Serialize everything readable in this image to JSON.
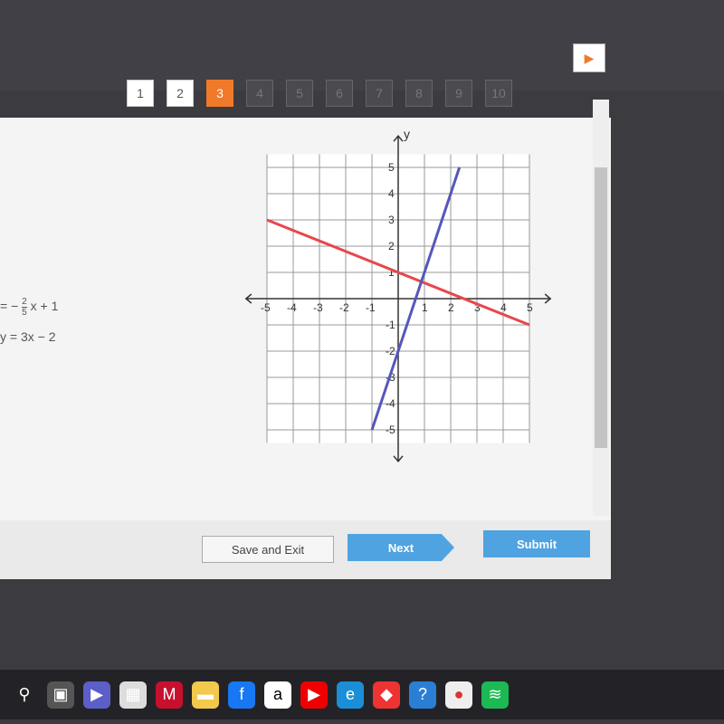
{
  "nav": {
    "pages": [
      {
        "label": "1",
        "state": "visited"
      },
      {
        "label": "2",
        "state": "visited"
      },
      {
        "label": "3",
        "state": "current"
      },
      {
        "label": "4",
        "state": "locked"
      },
      {
        "label": "5",
        "state": "locked"
      },
      {
        "label": "6",
        "state": "locked"
      },
      {
        "label": "7",
        "state": "locked"
      },
      {
        "label": "8",
        "state": "locked"
      },
      {
        "label": "9",
        "state": "locked"
      },
      {
        "label": "10",
        "state": "locked"
      }
    ],
    "next_icon": "play-arrow-icon",
    "accent": "#f07a2a"
  },
  "question": {
    "eq1": {
      "lhs": "=",
      "sign": "−",
      "num": "2",
      "den": "5",
      "rest": "x + 1"
    },
    "eq2": "y = 3x − 2"
  },
  "graph": {
    "y_label": "y",
    "x_ticks": [
      "-5",
      "-4",
      "-3",
      "-2",
      "-1",
      "1",
      "2",
      "3",
      "4",
      "5"
    ],
    "y_ticks": [
      "5",
      "4",
      "3",
      "2",
      "1",
      "-1",
      "-2",
      "-3",
      "-4",
      "-5"
    ],
    "lines": [
      {
        "equation": "y = -2/5x + 1",
        "color": "#e8474a",
        "slope": -0.4,
        "intercept": 1,
        "x_range": [
          -5,
          5
        ]
      },
      {
        "equation": "y = 3x - 2",
        "color": "#5558b8",
        "slope": 3,
        "intercept": -2,
        "x_range": [
          -1,
          2.333
        ]
      }
    ],
    "xlim": [
      -5,
      5
    ],
    "ylim": [
      -5,
      5
    ]
  },
  "buttons": {
    "save": "Save and Exit",
    "next": "Next",
    "submit": "Submit"
  },
  "taskbar": [
    "search-icon",
    "task-view-icon",
    "teams-icon",
    "store-icon",
    "mcafee-icon",
    "file-explorer-icon",
    "facebook-icon",
    "amazon-icon",
    "youtube-icon",
    "edge-icon",
    "app-icon",
    "help-icon",
    "chrome-icon",
    "spotify-icon"
  ]
}
